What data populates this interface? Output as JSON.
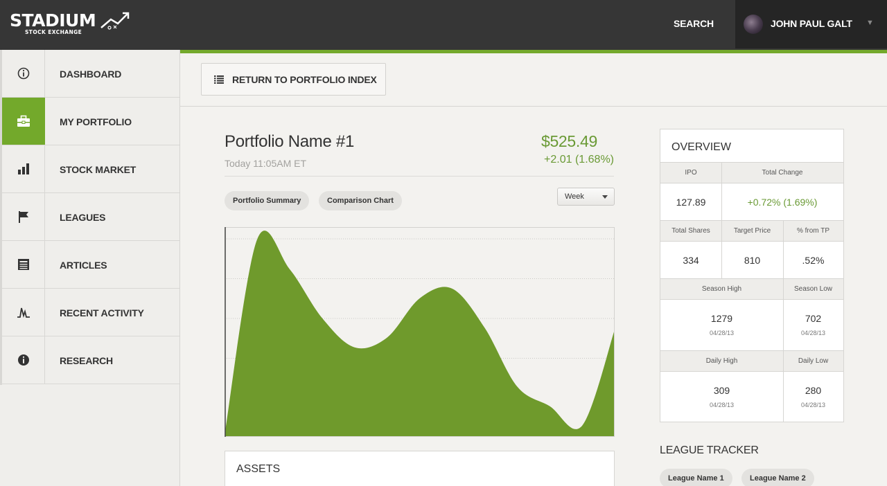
{
  "brand": {
    "name": "STADIUM",
    "tagline": "STOCK EXCHANGE"
  },
  "header": {
    "search_label": "SEARCH",
    "user_name": "JOHN PAUL GALT"
  },
  "sidebar": {
    "items": [
      {
        "label": "DASHBOARD",
        "icon": "info-circle-icon"
      },
      {
        "label": "MY PORTFOLIO",
        "icon": "briefcase-icon",
        "active": true
      },
      {
        "label": "STOCK MARKET",
        "icon": "bar-chart-icon"
      },
      {
        "label": "LEAGUES",
        "icon": "flag-icon"
      },
      {
        "label": "ARTICLES",
        "icon": "newspaper-icon"
      },
      {
        "label": "RECENT ACTIVITY",
        "icon": "activity-icon"
      },
      {
        "label": "RESEARCH",
        "icon": "info-solid-icon"
      }
    ]
  },
  "toolbar": {
    "return_label": "RETURN TO PORTFOLIO INDEX"
  },
  "portfolio": {
    "name": "Portfolio Name #1",
    "timestamp": "Today 11:05AM ET",
    "price": "$525.49",
    "change": "+2.01 (1.68%)",
    "tabs": [
      "Portfolio Summary",
      "Comparison Chart"
    ],
    "period": "Week"
  },
  "chart_data": {
    "type": "area",
    "x": [
      0,
      1,
      2,
      3,
      4,
      5,
      6,
      7,
      8,
      9,
      10,
      11,
      12
    ],
    "values": [
      0,
      100,
      85,
      60,
      45,
      50,
      70,
      75,
      55,
      25,
      15,
      5,
      54
    ],
    "ylim": [
      0,
      105
    ],
    "grid": true,
    "color": "#6f9a2c"
  },
  "assets": {
    "title": "ASSETS"
  },
  "overview": {
    "title": "OVERVIEW",
    "ipo_label": "IPO",
    "ipo": "127.89",
    "total_change_label": "Total Change",
    "total_change": "+0.72% (1.69%)",
    "total_shares_label": "Total Shares",
    "total_shares": "334",
    "target_price_label": "Target Price",
    "target_price": "810",
    "from_tp_label": "% from TP",
    "from_tp": ".52%",
    "season_high_label": "Season High",
    "season_high": "1279",
    "season_high_date": "04/28/13",
    "season_low_label": "Season Low",
    "season_low": "702",
    "season_low_date": "04/28/13",
    "daily_high_label": "Daily High",
    "daily_high": "309",
    "daily_high_date": "04/28/13",
    "daily_low_label": "Daily Low",
    "daily_low": "280",
    "daily_low_date": "04/28/13"
  },
  "league_tracker": {
    "title": "LEAGUE TRACKER",
    "leagues": [
      "League Name 1",
      "League Name 2"
    ]
  },
  "colors": {
    "accent": "#74a92c",
    "topbar": "#363636",
    "positive": "#6a9a35"
  }
}
